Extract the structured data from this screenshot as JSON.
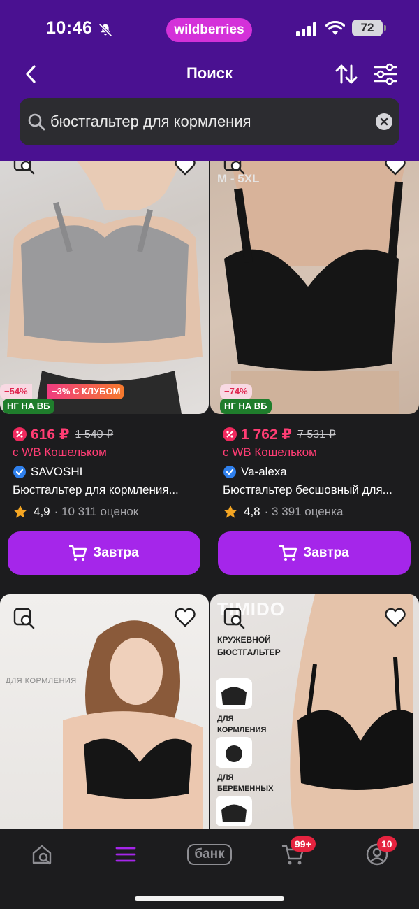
{
  "status": {
    "time": "10:46",
    "brand": "wildberries",
    "battery": "72"
  },
  "header": {
    "title": "Поиск"
  },
  "search": {
    "query": "бюстгальтер для кормления"
  },
  "products": [
    {
      "badge_discount": "−54%",
      "badge_club": "−3% С КЛУБОМ",
      "badge_promo": "НГ НА ВБ",
      "price": "616 ₽",
      "old_price": "1 540 ₽",
      "wallet": "с WB Кошельком",
      "seller": "SAVOSHI",
      "name": "Бюстгальтер для кормления...",
      "rating": "4,9",
      "reviews": "· 10 311 оценок",
      "cart_label": "Завтра"
    },
    {
      "overlay_text": "M - 5XL",
      "badge_discount": "−74%",
      "badge_promo": "НГ НА ВБ",
      "price": "1 762 ₽",
      "old_price": "7 531 ₽",
      "wallet": "с WB Кошельком",
      "seller": "Va-alexa",
      "name": "Бюстгальтер бесшовный для...",
      "rating": "4,8",
      "reviews": "· 3 391 оценка",
      "cart_label": "Завтра"
    },
    {
      "overlay_text": "ДЛЯ КОРМЛЕНИЯ"
    },
    {
      "brand_text": "TIMIDO",
      "promo_title": "КРУЖЕВНОЙ БЮСТГАЛЬТЕР",
      "feature1": "ДЛЯ КОРМЛЕНИЯ",
      "feature2": "ДЛЯ БЕРЕМЕННЫХ"
    }
  ],
  "bottom_nav": {
    "bank_label": "банк",
    "cart_count": "99+",
    "profile_count": "10"
  },
  "colors": {
    "header": "#4a1191",
    "brand_pill": "#d431d9",
    "accent_button": "#a526ea",
    "price": "#ff3d74",
    "promo_green": "#1f7d2c"
  }
}
